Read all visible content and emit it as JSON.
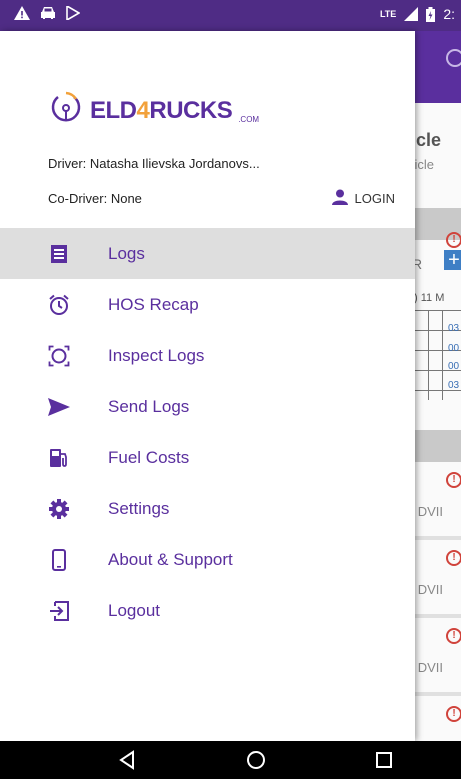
{
  "status_bar": {
    "network": "LTE",
    "time": "2:"
  },
  "background": {
    "vehicle_title": "hicle",
    "vehicle_subtitle": "ehicle",
    "r_letter": "R",
    "hours_label": ") 11 M",
    "grid_values": [
      "03",
      "00",
      "00",
      "03"
    ],
    "dvir_rows": [
      "lo DVII",
      "lo DVII",
      "lo DVII"
    ]
  },
  "drawer": {
    "logo": {
      "text_a": "ELD",
      "text_b": "4",
      "text_c": "RUCKS",
      "suffix": ".COM"
    },
    "driver": "Driver: Natasha Ilievska Jordanovs...",
    "co_driver": "Co-Driver: None",
    "login_label": "LOGIN",
    "menu": [
      {
        "label": "Logs",
        "icon": "logs-icon"
      },
      {
        "label": "HOS Recap",
        "icon": "alarm-clock-icon"
      },
      {
        "label": "Inspect Logs",
        "icon": "inspect-icon"
      },
      {
        "label": "Send Logs",
        "icon": "send-icon"
      },
      {
        "label": "Fuel Costs",
        "icon": "fuel-pump-icon"
      },
      {
        "label": "Settings",
        "icon": "gear-icon"
      },
      {
        "label": "About & Support",
        "icon": "phone-icon"
      },
      {
        "label": "Logout",
        "icon": "logout-icon"
      }
    ]
  },
  "colors": {
    "brand": "#5a2f9e",
    "accent": "#f2a13a",
    "status_bar": "#4f2c85",
    "active_row": "#dedede"
  }
}
